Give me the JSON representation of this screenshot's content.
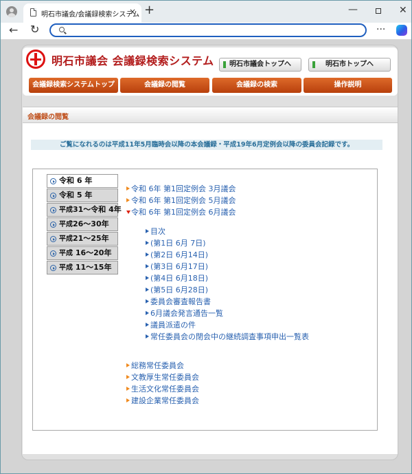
{
  "browser": {
    "tab_title": "明石市議会/会議録検索システム",
    "address_value": "",
    "close_glyph": "×",
    "new_tab_glyph": "+",
    "back_glyph": "←",
    "reload_glyph": "↻",
    "menu_glyph": "···",
    "minimize_glyph": "—",
    "window_close_glyph": "✕"
  },
  "header": {
    "site_title": "明石市議会 会議録検索システム",
    "btn_giki": "明石市議会トップへ",
    "btn_city": "明石市トップへ",
    "logo_color": "#d11111"
  },
  "nav": {
    "top": "会議録検索システムトップ",
    "view": "会議録の閲覧",
    "search": "会議録の検索",
    "help": "操作説明",
    "accent": "#c8501a"
  },
  "section": {
    "title": "会議録の閲覧",
    "notice": "ご覧になれるのは平成11年5月臨時会以降の本会議録・平成19年6月定例会以降の委員会記録です。"
  },
  "years": [
    {
      "era": "令和",
      "label": " 6 年",
      "active": true
    },
    {
      "era": "令和",
      "label": " 5 年",
      "active": false
    },
    {
      "era": "平成",
      "label": "31～令和 4年",
      "active": false
    },
    {
      "era": "平成",
      "label": "26～30年",
      "active": false
    },
    {
      "era": "平成",
      "label": "21～25年",
      "active": false
    },
    {
      "era": "平成",
      "label": " 16～20年",
      "active": false
    },
    {
      "era": "平成",
      "label": " 11～15年",
      "active": false
    }
  ],
  "sessions": [
    {
      "label": "令和 6年 第1回定例会 3月議会",
      "expanded": false
    },
    {
      "label": "令和 6年 第1回定例会 5月議会",
      "expanded": false
    },
    {
      "label": "令和 6年 第1回定例会 6月議会",
      "expanded": true
    }
  ],
  "sub_items": [
    "目次",
    "(第1日 6月 7日)",
    "(第2日 6月14日)",
    "(第3日 6月17日)",
    "(第4日 6月18日)",
    "(第5日 6月28日)",
    "委員会審査報告書",
    "6月議会発言通告一覧",
    "議員派遣の件",
    "常任委員会の閉会中の継続調査事項申出一覧表"
  ],
  "committees": [
    "総務常任委員会",
    "文教厚生常任委員会",
    "生活文化常任委員会",
    "建設企業常任委員会"
  ]
}
